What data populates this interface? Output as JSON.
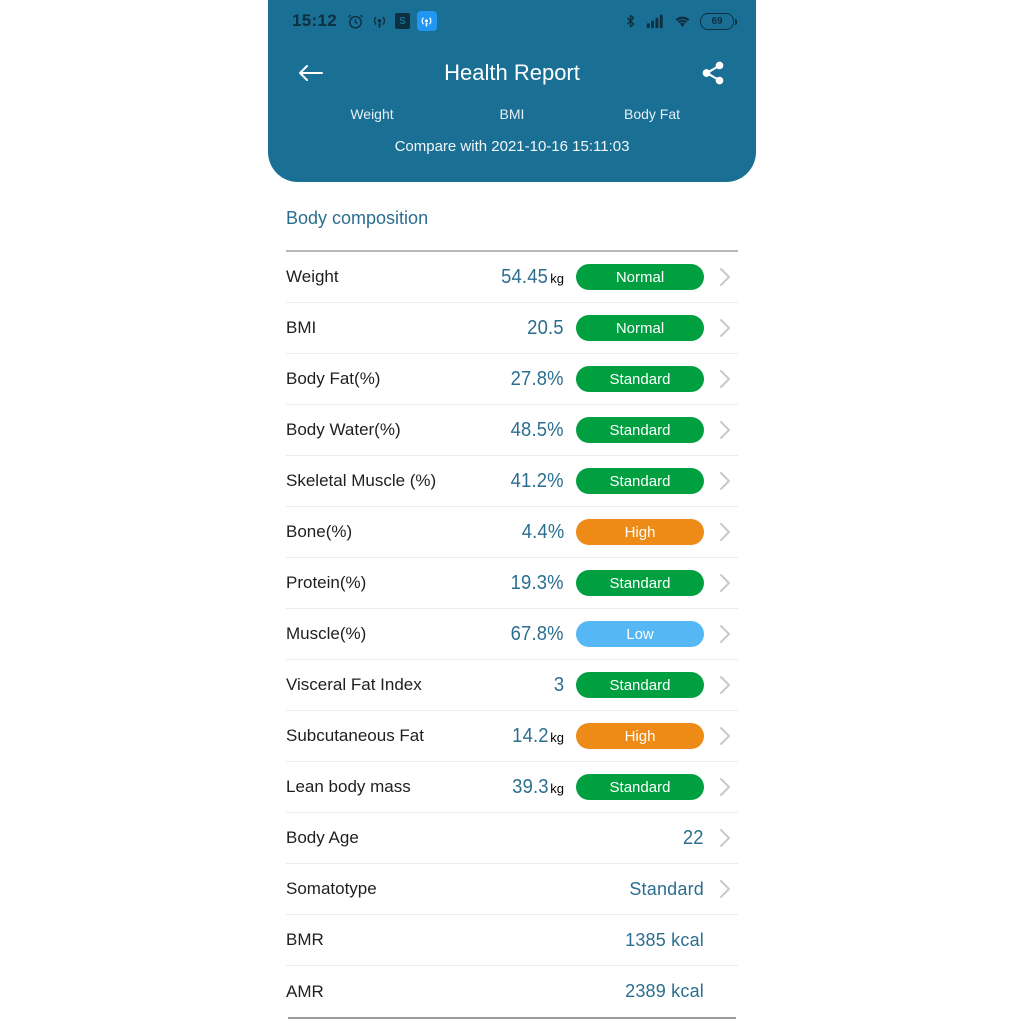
{
  "statusbar": {
    "time": "15:12",
    "icons": [
      "alarm-icon",
      "hotspot-icon",
      "shop-icon",
      "hotspot-active-icon"
    ],
    "shop_letter": "S",
    "right_icons": [
      "bluetooth-icon",
      "cellular-signal-icon",
      "wifi-icon"
    ],
    "battery_level": "69"
  },
  "header": {
    "title": "Health Report",
    "back_icon": "back-arrow-icon",
    "share_icon": "share-icon",
    "tabs": [
      {
        "label": "Weight"
      },
      {
        "label": "BMI"
      },
      {
        "label": "Body Fat"
      }
    ],
    "compare_text": "Compare with 2021-10-16 15:11:03",
    "background_color": "#1a6f94"
  },
  "main": {
    "section_title": "Body composition",
    "colors": {
      "value_text": "#2b6e8f",
      "badge_normal": "#00A040",
      "badge_standard": "#00A040",
      "badge_high": "#ED8B16",
      "badge_low": "#55B8F5"
    },
    "rows": [
      {
        "label": "Weight",
        "value": "54.45",
        "unit": "kg",
        "badge": "Normal",
        "badge_type": "normal",
        "chevron": true
      },
      {
        "label": "BMI",
        "value": "20.5",
        "unit": "",
        "badge": "Normal",
        "badge_type": "normal",
        "chevron": true
      },
      {
        "label": "Body Fat(%)",
        "value": "27.8%",
        "unit": "",
        "badge": "Standard",
        "badge_type": "standard",
        "chevron": true
      },
      {
        "label": "Body Water(%)",
        "value": "48.5%",
        "unit": "",
        "badge": "Standard",
        "badge_type": "standard",
        "chevron": true
      },
      {
        "label": "Skeletal Muscle (%)",
        "value": "41.2%",
        "unit": "",
        "badge": "Standard",
        "badge_type": "standard",
        "chevron": true
      },
      {
        "label": "Bone(%)",
        "value": "4.4%",
        "unit": "",
        "badge": "High",
        "badge_type": "high",
        "chevron": true
      },
      {
        "label": "Protein(%)",
        "value": "19.3%",
        "unit": "",
        "badge": "Standard",
        "badge_type": "standard",
        "chevron": true
      },
      {
        "label": "Muscle(%)",
        "value": "67.8%",
        "unit": "",
        "badge": "Low",
        "badge_type": "low",
        "chevron": true
      },
      {
        "label": "Visceral Fat Index",
        "value": "3",
        "unit": "",
        "badge": "Standard",
        "badge_type": "standard",
        "chevron": true
      },
      {
        "label": "Subcutaneous Fat",
        "value": "14.2",
        "unit": "kg",
        "badge": "High",
        "badge_type": "high",
        "chevron": true
      },
      {
        "label": "Lean body mass",
        "value": "39.3",
        "unit": "kg",
        "badge": "Standard",
        "badge_type": "standard",
        "chevron": true
      },
      {
        "label": "Body Age",
        "value": "22",
        "unit": "",
        "badge": "",
        "badge_type": "",
        "chevron": true
      },
      {
        "label": "Somatotype",
        "value": "Standard",
        "unit": "",
        "badge": "",
        "badge_type": "",
        "chevron": true,
        "plain": true
      },
      {
        "label": "BMR",
        "value": "1385 kcal",
        "unit": "",
        "badge": "",
        "badge_type": "",
        "chevron": false,
        "plain": true
      },
      {
        "label": "AMR",
        "value": "2389 kcal",
        "unit": "",
        "badge": "",
        "badge_type": "",
        "chevron": false,
        "plain": true
      }
    ]
  }
}
